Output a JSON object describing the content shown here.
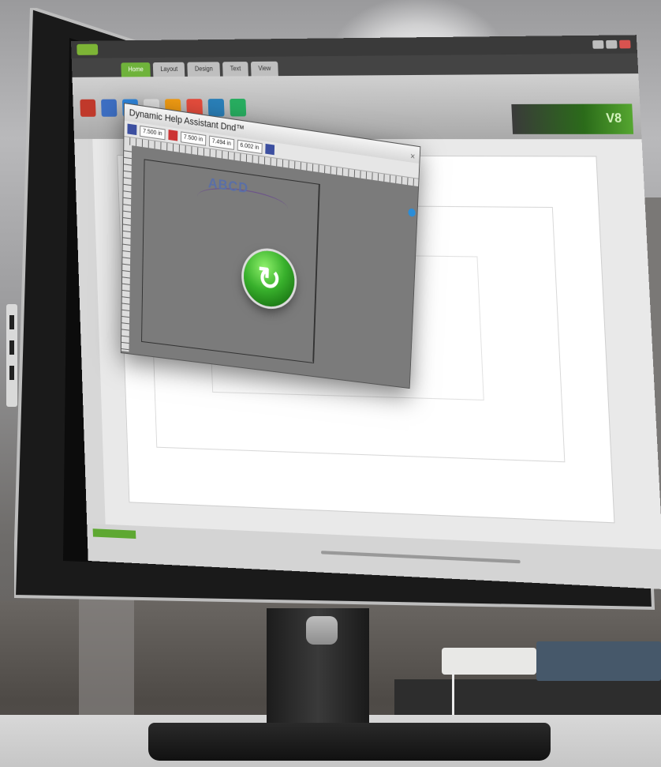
{
  "app": {
    "tabs": [
      "Home",
      "Layout",
      "Design",
      "Text",
      "View"
    ],
    "active_tab": "Home",
    "logo_text": "V8"
  },
  "dialog": {
    "title": "Dynamic Help Assistant Dnd™",
    "close_glyph": "×",
    "fields": [
      "7.500 in",
      "7.500 in",
      "7.494 in",
      "6.002 in"
    ],
    "sample_text": "ABCD",
    "go_glyph": "↻"
  },
  "statusbar": {
    "left_text": "",
    "readout": ""
  },
  "colors": {
    "accent_green": "#6fb33b",
    "go_button": "#38b02c"
  }
}
